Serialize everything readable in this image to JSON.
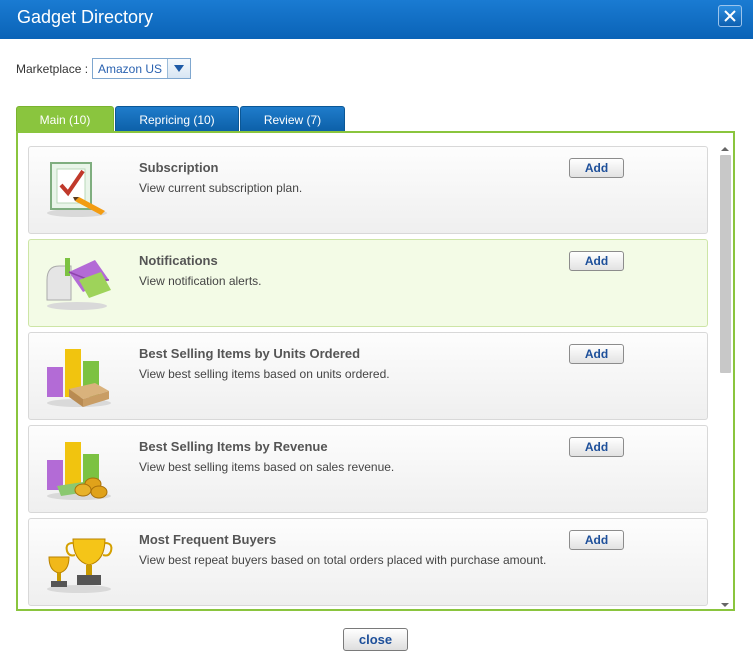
{
  "window": {
    "title": "Gadget Directory"
  },
  "marketplace": {
    "label": "Marketplace :",
    "selected": "Amazon US"
  },
  "tabs": [
    {
      "label": "Main (10)",
      "active": true
    },
    {
      "label": "Repricing (10)",
      "active": false
    },
    {
      "label": "Review (7)",
      "active": false
    }
  ],
  "gadgets": [
    {
      "title": "Subscription",
      "description": "View current subscription plan.",
      "icon": "checklist-pencil-icon",
      "button": "Add"
    },
    {
      "title": "Notifications",
      "description": "View notification alerts.",
      "icon": "mailbox-letters-icon",
      "button": "Add"
    },
    {
      "title": "Best Selling Items by Units Ordered",
      "description": "View best selling items based on units ordered.",
      "icon": "podium-boxes-icon",
      "button": "Add"
    },
    {
      "title": "Best Selling Items by Revenue",
      "description": "View best selling items based on sales revenue.",
      "icon": "podium-coins-icon",
      "button": "Add"
    },
    {
      "title": "Most Frequent Buyers",
      "description": "View best repeat buyers based on total orders placed with purchase amount.",
      "icon": "trophies-icon",
      "button": "Add"
    }
  ],
  "footer": {
    "close_label": "close"
  }
}
